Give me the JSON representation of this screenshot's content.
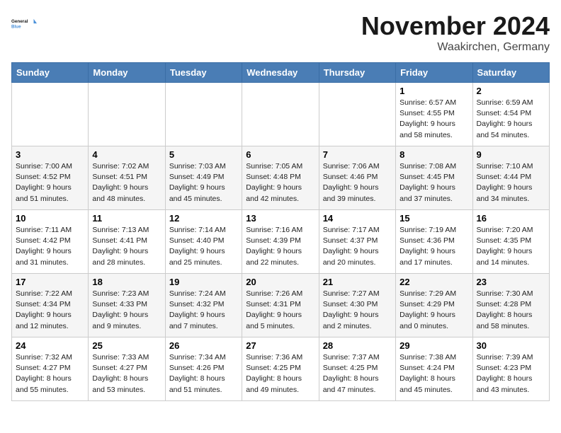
{
  "header": {
    "logo_line1": "General",
    "logo_line2": "Blue",
    "month": "November 2024",
    "location": "Waakirchen, Germany"
  },
  "weekdays": [
    "Sunday",
    "Monday",
    "Tuesday",
    "Wednesday",
    "Thursday",
    "Friday",
    "Saturday"
  ],
  "weeks": [
    [
      {
        "day": "",
        "info": ""
      },
      {
        "day": "",
        "info": ""
      },
      {
        "day": "",
        "info": ""
      },
      {
        "day": "",
        "info": ""
      },
      {
        "day": "",
        "info": ""
      },
      {
        "day": "1",
        "info": "Sunrise: 6:57 AM\nSunset: 4:55 PM\nDaylight: 9 hours and 58 minutes."
      },
      {
        "day": "2",
        "info": "Sunrise: 6:59 AM\nSunset: 4:54 PM\nDaylight: 9 hours and 54 minutes."
      }
    ],
    [
      {
        "day": "3",
        "info": "Sunrise: 7:00 AM\nSunset: 4:52 PM\nDaylight: 9 hours and 51 minutes."
      },
      {
        "day": "4",
        "info": "Sunrise: 7:02 AM\nSunset: 4:51 PM\nDaylight: 9 hours and 48 minutes."
      },
      {
        "day": "5",
        "info": "Sunrise: 7:03 AM\nSunset: 4:49 PM\nDaylight: 9 hours and 45 minutes."
      },
      {
        "day": "6",
        "info": "Sunrise: 7:05 AM\nSunset: 4:48 PM\nDaylight: 9 hours and 42 minutes."
      },
      {
        "day": "7",
        "info": "Sunrise: 7:06 AM\nSunset: 4:46 PM\nDaylight: 9 hours and 39 minutes."
      },
      {
        "day": "8",
        "info": "Sunrise: 7:08 AM\nSunset: 4:45 PM\nDaylight: 9 hours and 37 minutes."
      },
      {
        "day": "9",
        "info": "Sunrise: 7:10 AM\nSunset: 4:44 PM\nDaylight: 9 hours and 34 minutes."
      }
    ],
    [
      {
        "day": "10",
        "info": "Sunrise: 7:11 AM\nSunset: 4:42 PM\nDaylight: 9 hours and 31 minutes."
      },
      {
        "day": "11",
        "info": "Sunrise: 7:13 AM\nSunset: 4:41 PM\nDaylight: 9 hours and 28 minutes."
      },
      {
        "day": "12",
        "info": "Sunrise: 7:14 AM\nSunset: 4:40 PM\nDaylight: 9 hours and 25 minutes."
      },
      {
        "day": "13",
        "info": "Sunrise: 7:16 AM\nSunset: 4:39 PM\nDaylight: 9 hours and 22 minutes."
      },
      {
        "day": "14",
        "info": "Sunrise: 7:17 AM\nSunset: 4:37 PM\nDaylight: 9 hours and 20 minutes."
      },
      {
        "day": "15",
        "info": "Sunrise: 7:19 AM\nSunset: 4:36 PM\nDaylight: 9 hours and 17 minutes."
      },
      {
        "day": "16",
        "info": "Sunrise: 7:20 AM\nSunset: 4:35 PM\nDaylight: 9 hours and 14 minutes."
      }
    ],
    [
      {
        "day": "17",
        "info": "Sunrise: 7:22 AM\nSunset: 4:34 PM\nDaylight: 9 hours and 12 minutes."
      },
      {
        "day": "18",
        "info": "Sunrise: 7:23 AM\nSunset: 4:33 PM\nDaylight: 9 hours and 9 minutes."
      },
      {
        "day": "19",
        "info": "Sunrise: 7:24 AM\nSunset: 4:32 PM\nDaylight: 9 hours and 7 minutes."
      },
      {
        "day": "20",
        "info": "Sunrise: 7:26 AM\nSunset: 4:31 PM\nDaylight: 9 hours and 5 minutes."
      },
      {
        "day": "21",
        "info": "Sunrise: 7:27 AM\nSunset: 4:30 PM\nDaylight: 9 hours and 2 minutes."
      },
      {
        "day": "22",
        "info": "Sunrise: 7:29 AM\nSunset: 4:29 PM\nDaylight: 9 hours and 0 minutes."
      },
      {
        "day": "23",
        "info": "Sunrise: 7:30 AM\nSunset: 4:28 PM\nDaylight: 8 hours and 58 minutes."
      }
    ],
    [
      {
        "day": "24",
        "info": "Sunrise: 7:32 AM\nSunset: 4:27 PM\nDaylight: 8 hours and 55 minutes."
      },
      {
        "day": "25",
        "info": "Sunrise: 7:33 AM\nSunset: 4:27 PM\nDaylight: 8 hours and 53 minutes."
      },
      {
        "day": "26",
        "info": "Sunrise: 7:34 AM\nSunset: 4:26 PM\nDaylight: 8 hours and 51 minutes."
      },
      {
        "day": "27",
        "info": "Sunrise: 7:36 AM\nSunset: 4:25 PM\nDaylight: 8 hours and 49 minutes."
      },
      {
        "day": "28",
        "info": "Sunrise: 7:37 AM\nSunset: 4:25 PM\nDaylight: 8 hours and 47 minutes."
      },
      {
        "day": "29",
        "info": "Sunrise: 7:38 AM\nSunset: 4:24 PM\nDaylight: 8 hours and 45 minutes."
      },
      {
        "day": "30",
        "info": "Sunrise: 7:39 AM\nSunset: 4:23 PM\nDaylight: 8 hours and 43 minutes."
      }
    ]
  ]
}
